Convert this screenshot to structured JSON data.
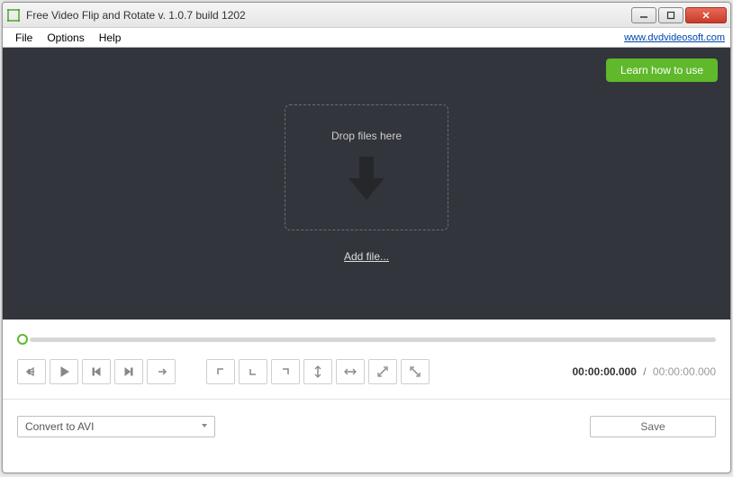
{
  "titlebar": {
    "title": "Free Video Flip and Rotate v. 1.0.7 build 1202"
  },
  "menubar": {
    "file": "File",
    "options": "Options",
    "help": "Help",
    "link": "www.dvdvideosoft.com"
  },
  "canvas": {
    "learn_label": "Learn how to use",
    "drop_label": "Drop files here",
    "add_file_label": "Add file..."
  },
  "time": {
    "current": "00:00:00.000",
    "sep": "/",
    "total": "00:00:00.000"
  },
  "bottom": {
    "format_label": "Convert to AVI",
    "save_label": "Save"
  }
}
